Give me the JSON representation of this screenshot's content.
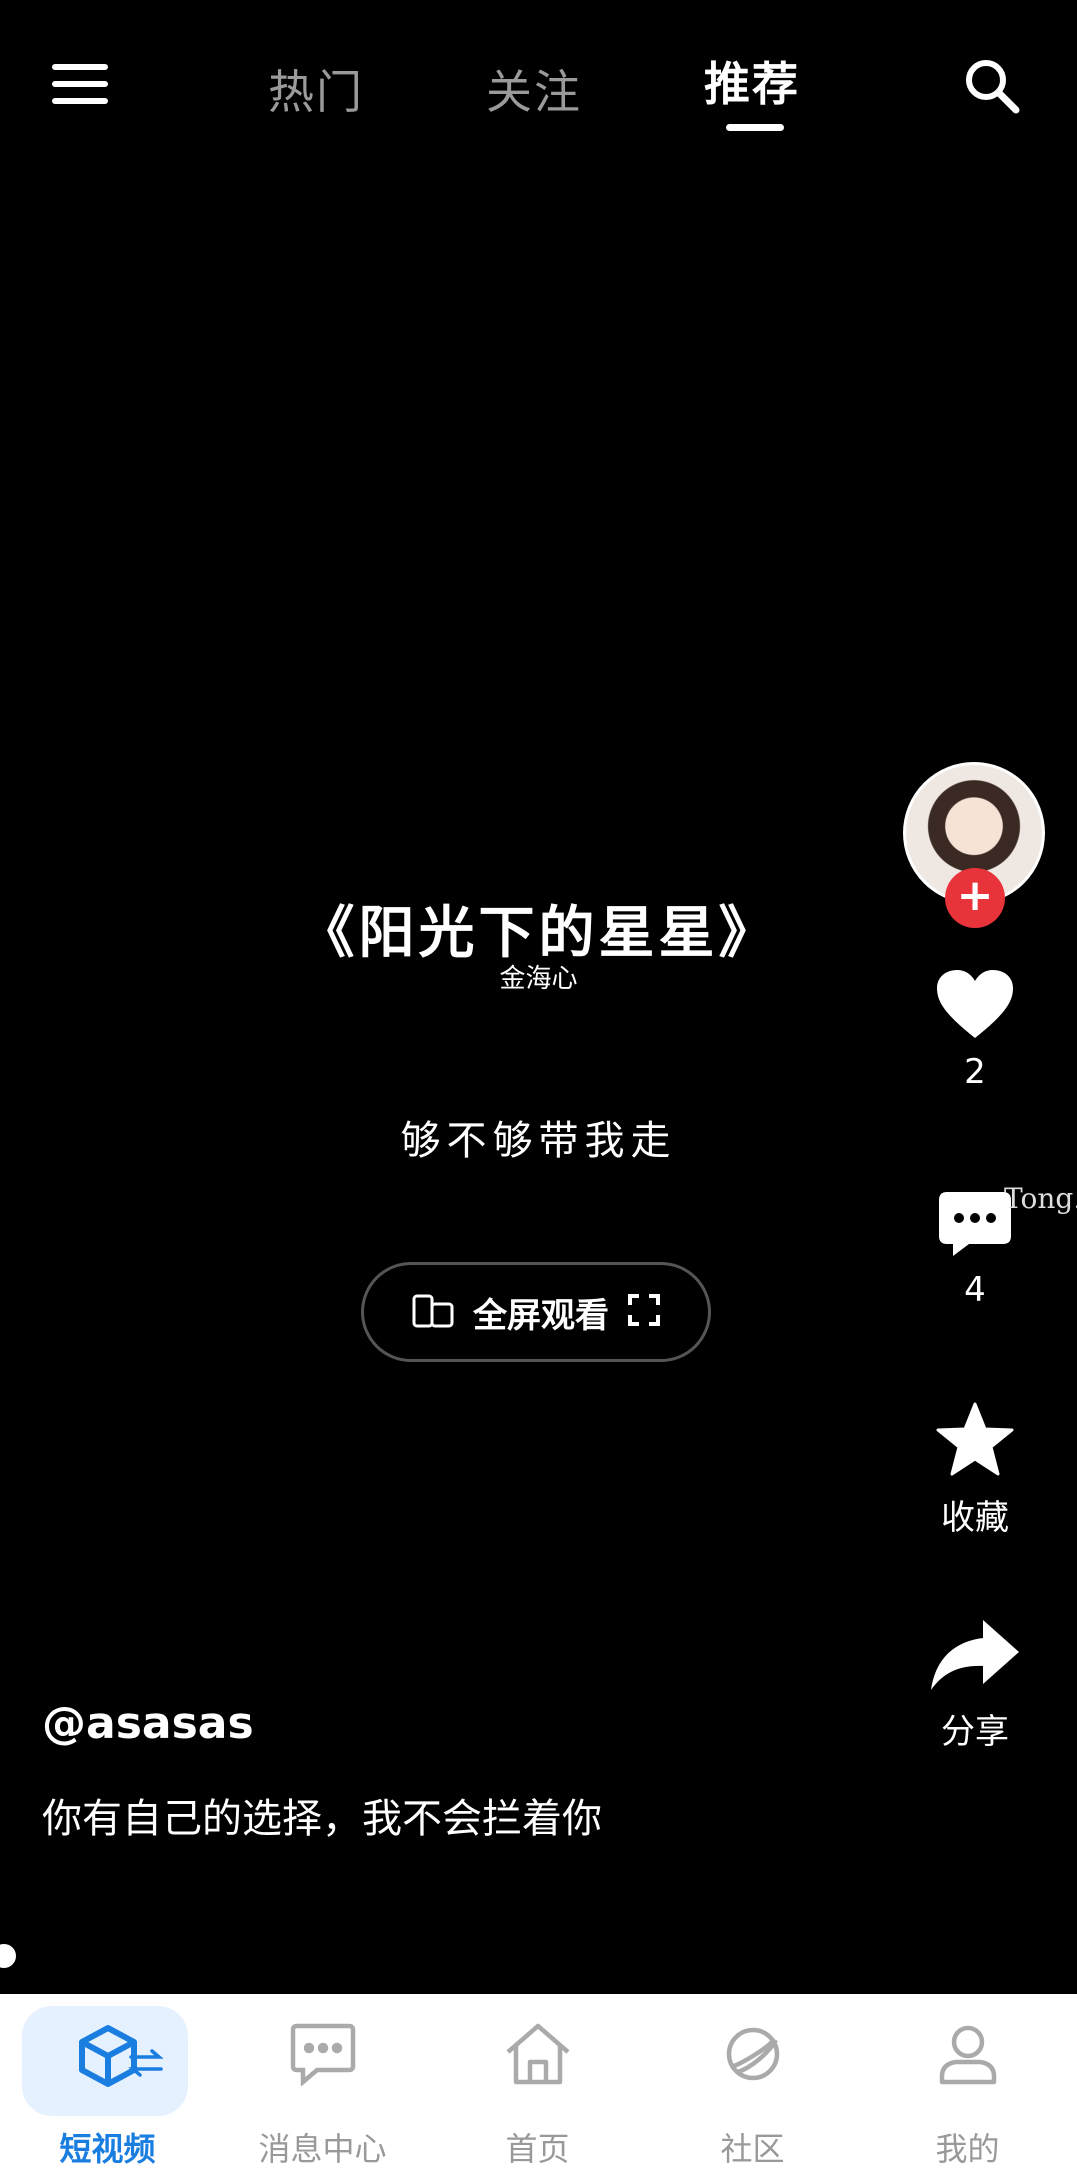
{
  "header": {
    "tabs": [
      {
        "label": "热门",
        "active": false
      },
      {
        "label": "关注",
        "active": false
      },
      {
        "label": "推荐",
        "active": true
      }
    ]
  },
  "video": {
    "title": "《阳光下的星星》",
    "artist": "金海心",
    "lyric": "够不够带我走",
    "fullscreen_label": "全屏观看"
  },
  "actions": {
    "likes": "2",
    "comments": "4",
    "favorite_label": "收藏",
    "share_label": "分享",
    "floating_text": "Tong."
  },
  "post": {
    "author": "@asasas",
    "description": "你有自己的选择，我不会拦着你"
  },
  "bottom_nav": {
    "items": [
      {
        "label": "短视频",
        "icon": "cube-icon",
        "active": true
      },
      {
        "label": "消息中心",
        "icon": "chat-icon",
        "active": false
      },
      {
        "label": "首页",
        "icon": "home-icon",
        "active": false
      },
      {
        "label": "社区",
        "icon": "planet-icon",
        "active": false
      },
      {
        "label": "我的",
        "icon": "user-icon",
        "active": false
      }
    ]
  },
  "colors": {
    "accent": "#1a7de0",
    "follow": "#e8333b",
    "background": "#000000"
  }
}
